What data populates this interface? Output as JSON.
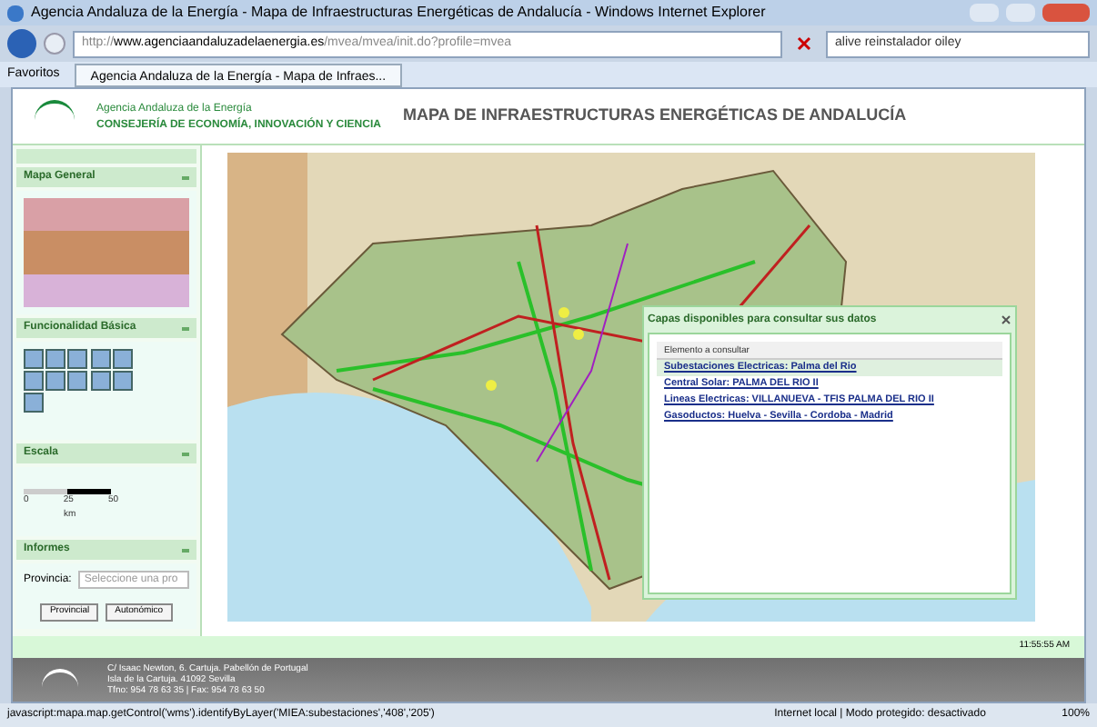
{
  "window": {
    "title": "Agencia Andaluza de la Energía - Mapa de Infraestructuras Energéticas de Andalucía - Windows Internet Explorer"
  },
  "address_bar": {
    "url": "http://www.agenciaandaluzadelaenergia.es/mvea/mvea/init.do?profile=mvea",
    "search_value": "alive reinstalador oiley"
  },
  "favorites": {
    "label": "Favoritos"
  },
  "tabs": [
    {
      "label": "Agencia Andaluza de la Energía - Mapa de Infraes...",
      "selected": true
    }
  ],
  "header": {
    "org": "Agencia Andaluza de la Energía",
    "ministry": "CONSEJERÍA DE ECONOMÍA, INNOVACIÓN Y CIENCIA",
    "title": "MAPA DE INFRAESTRUCTURAS ENERGÉTICAS DE ANDALUCÍA"
  },
  "sidebar": {
    "panels": [
      {
        "kind": "overview",
        "title": "Mapa General"
      },
      {
        "kind": "tools",
        "title": "Funcionalidad Básica"
      },
      {
        "kind": "scale",
        "title": "Escala",
        "ticks": [
          "0",
          "25",
          "50"
        ],
        "unit": "km"
      },
      {
        "kind": "reports",
        "title": "Informes",
        "field_label": "Provincia:",
        "placeholder": "Seleccione una pro",
        "buttons": [
          "Provincial",
          "Autonómico"
        ]
      }
    ]
  },
  "popup": {
    "title": "Capas disponibles para consultar sus datos",
    "column": "Elemento a consultar",
    "rows": [
      {
        "text": "Subestaciones Electricas: Palma del Rio",
        "selected": true
      },
      {
        "text": "Central Solar: PALMA DEL RIO II",
        "selected": false
      },
      {
        "text": "Lineas Electricas: VILLANUEVA - TFIS PALMA DEL RIO II",
        "selected": false
      },
      {
        "text": "Gasoductos: Huelva - Sevilla - Cordoba - Madrid",
        "selected": false
      }
    ]
  },
  "map_status": {
    "time": "11:55:55 AM"
  },
  "footer": {
    "lines": [
      "C/ Isaac Newton, 6. Cartuja. Pabellón de Portugal",
      "Isla de la Cartuja. 41092 Sevilla",
      "Tfno: 954 78 63 35 | Fax: 954 78 63 50"
    ]
  },
  "status_bar": {
    "message": "javascript:mapa.map.getControl('wms').identifyByLayer('MIEA:subestaciones','408','205')",
    "zone": "Internet local | Modo protegido: desactivado",
    "zoom": "100%"
  }
}
